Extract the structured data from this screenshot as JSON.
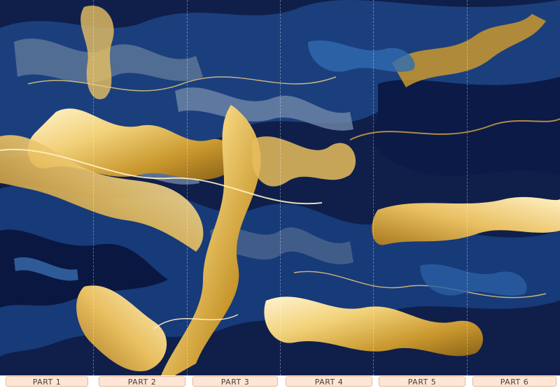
{
  "artwork": {
    "description_icon": "abstract-marble-icon",
    "colors": {
      "navy": "#0f1f4a",
      "deep_navy": "#081232",
      "blue": "#1f4d8f",
      "steel": "#5a7597",
      "gold": "#c9982e",
      "light_gold": "#f2d27a",
      "cream": "#fff3cf"
    }
  },
  "panels": [
    {
      "label": "PART 1"
    },
    {
      "label": "PART 2"
    },
    {
      "label": "PART 3"
    },
    {
      "label": "PART 4"
    },
    {
      "label": "PART 5"
    },
    {
      "label": "PART 6"
    }
  ],
  "label_colors": {
    "background": "#fde6d6",
    "border": "#e7b79a",
    "text": "#4a3b33"
  }
}
